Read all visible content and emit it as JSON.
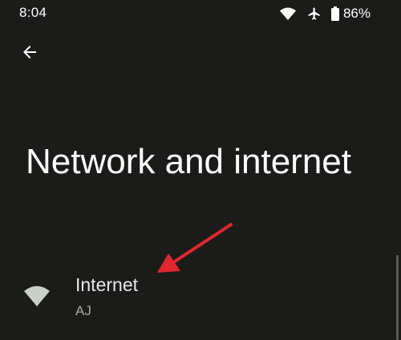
{
  "status_bar": {
    "time": "8:04",
    "battery_percent": "86%",
    "icons": [
      "wifi-icon",
      "airplane-icon",
      "battery-icon"
    ]
  },
  "toolbar": {
    "back_icon": "arrow-back-icon"
  },
  "page": {
    "title": "Network and internet"
  },
  "items": [
    {
      "title": "Internet",
      "summary": "AJ",
      "icon": "wifi-icon"
    }
  ],
  "colors": {
    "background": "#1b1c1a",
    "text_primary": "#ffffff",
    "text_secondary": "#a8a8a6",
    "icon_tint": "#c9d0c5",
    "annotation_arrow": "#e0282e"
  }
}
